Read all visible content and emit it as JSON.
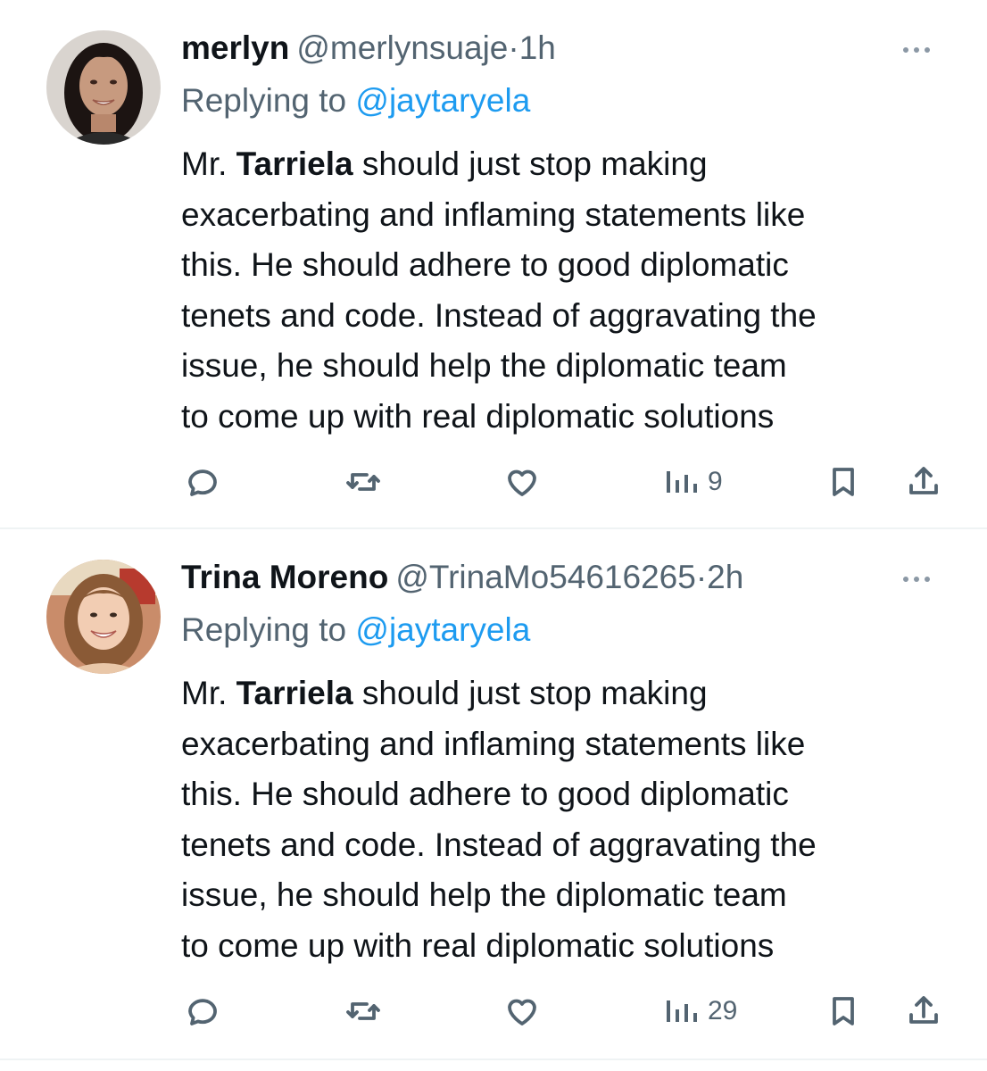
{
  "tweets": [
    {
      "name": "merlyn",
      "handle": "@merlynsuaje",
      "dot": "·",
      "time": "1h",
      "replying_label": "Replying to ",
      "replying_to": "@jaytaryela",
      "body_lines": [
        [
          "Mr. ",
          "Tarriela",
          " should just stop making"
        ],
        "exacerbating and inflaming statements like",
        "this. He should adhere to good diplomatic",
        "tenets and code. Instead of aggravating the",
        "issue, he should help the diplomatic team",
        "to come up with real diplomatic solutions"
      ],
      "views": "9",
      "icons": [
        "reply-icon",
        "retweet-icon",
        "like-icon",
        "views-icon",
        "bookmark-icon",
        "share-icon"
      ]
    },
    {
      "name": "Trina Moreno",
      "handle": "@TrinaMo54616265",
      "dot": "·",
      "time": "2h",
      "replying_label": "Replying to ",
      "replying_to": "@jaytaryela",
      "body_lines": [
        [
          "Mr. ",
          "Tarriela",
          " should just stop making"
        ],
        "exacerbating and inflaming statements like",
        "this. He should adhere to good diplomatic",
        "tenets and code. Instead of aggravating the",
        "issue, he should help the diplomatic team",
        "to come up with real diplomatic solutions"
      ],
      "views": "29",
      "icons": [
        "reply-icon",
        "retweet-icon",
        "like-icon",
        "views-icon",
        "bookmark-icon",
        "share-icon"
      ]
    }
  ],
  "colors": {
    "text": "#0f1419",
    "secondary": "#536471",
    "link": "#1d9bf0",
    "divider": "#eff3f4"
  }
}
